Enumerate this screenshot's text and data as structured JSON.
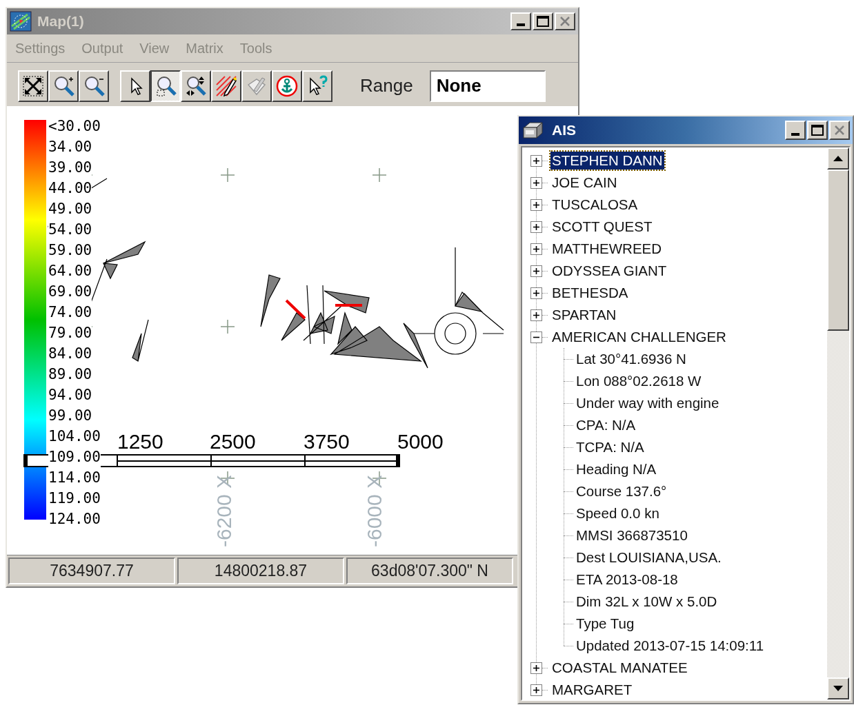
{
  "map_window": {
    "title": "Map(1)",
    "menu": [
      "Settings",
      "Output",
      "View",
      "Matrix",
      "Tools"
    ],
    "toolbar": {
      "tools": [
        {
          "kind": "extent",
          "selected": false
        },
        {
          "kind": "zoom-in",
          "selected": false
        },
        {
          "kind": "zoom-out",
          "selected": false
        },
        {
          "kind": "pointer",
          "selected": false
        },
        {
          "kind": "zoom-box",
          "selected": true
        },
        {
          "kind": "zoom-pan",
          "selected": false
        },
        {
          "kind": "draw",
          "selected": false
        },
        {
          "kind": "edit",
          "selected": false
        },
        {
          "kind": "anchor",
          "selected": false
        },
        {
          "kind": "help",
          "selected": false
        }
      ],
      "range_label": "Range",
      "range_value": "None"
    },
    "legend": [
      "<30.00",
      "34.00",
      "39.00",
      "44.00",
      "49.00",
      "54.00",
      "59.00",
      "64.00",
      "69.00",
      "74.00",
      "79.00",
      "84.00",
      "89.00",
      "94.00",
      "99.00",
      "104.00",
      "109.00",
      "114.00",
      "119.00",
      "124.00"
    ],
    "grid_x_labels": [
      "-6200 X",
      "-6000 X"
    ],
    "scale_labels": [
      "1250",
      "2500",
      "3750",
      "5000"
    ],
    "status_bar": [
      "7634907.77",
      "14800218.87",
      "63d08'07.300\" N"
    ]
  },
  "ais_window": {
    "title": "AIS",
    "vessels": [
      {
        "name": "STEPHEN DANN",
        "expanded": false,
        "selected": true
      },
      {
        "name": "JOE CAIN",
        "expanded": false,
        "selected": false
      },
      {
        "name": "TUSCALOSA",
        "expanded": false,
        "selected": false
      },
      {
        "name": "SCOTT QUEST",
        "expanded": false,
        "selected": false
      },
      {
        "name": "MATTHEWREED",
        "expanded": false,
        "selected": false
      },
      {
        "name": "ODYSSEA GIANT",
        "expanded": false,
        "selected": false
      },
      {
        "name": "BETHESDA",
        "expanded": false,
        "selected": false
      },
      {
        "name": "SPARTAN",
        "expanded": false,
        "selected": false
      },
      {
        "name": "AMERICAN CHALLENGER",
        "expanded": true,
        "selected": false,
        "children": [
          "Lat 30°41.6936 N",
          "Lon 088°02.2618 W",
          "Under way with engine",
          "CPA: N/A",
          "TCPA: N/A",
          "Heading N/A",
          "Course 137.6°",
          "Speed 0.0 kn",
          "MMSI 366873510",
          "Dest LOUISIANA,USA.",
          "ETA 2013-08-18",
          "Dim 32L x 10W x 5.0D",
          "Type Tug",
          "Updated 2013-07-15 14:09:11"
        ]
      },
      {
        "name": "COASTAL MANATEE",
        "expanded": false,
        "selected": false
      },
      {
        "name": "MARGARET",
        "expanded": false,
        "selected": false
      }
    ]
  }
}
